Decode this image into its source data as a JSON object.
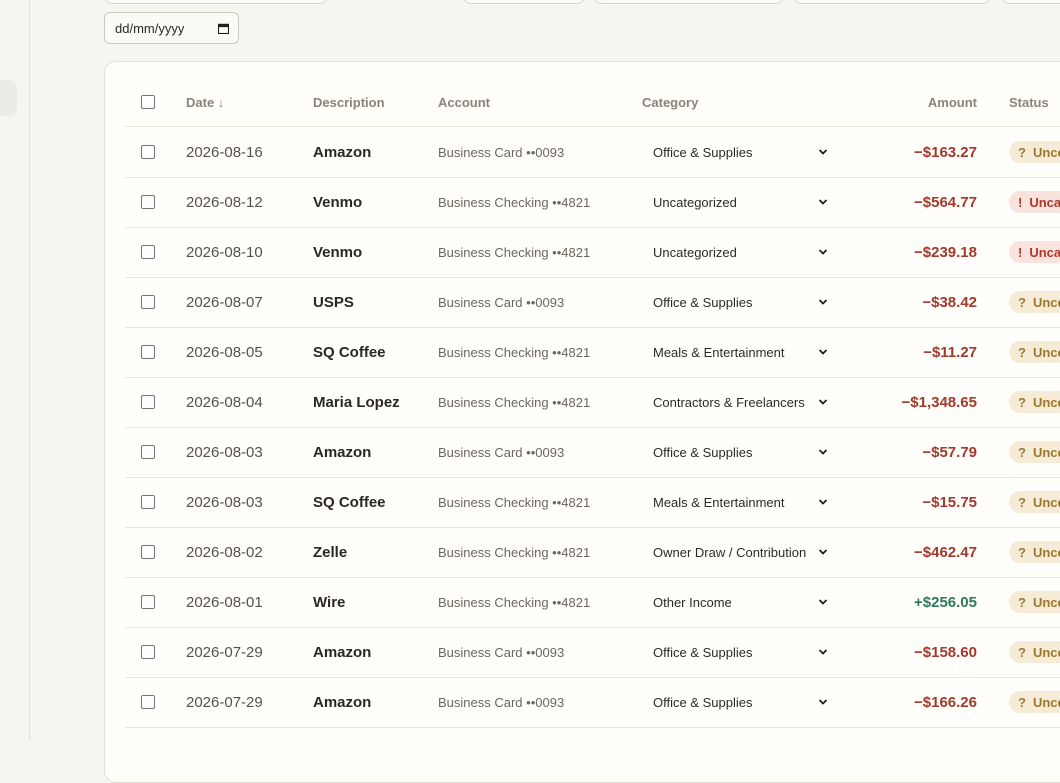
{
  "filters": {
    "date_placeholder": "dd/mm/yyyy"
  },
  "table": {
    "headers": {
      "date": "Date ↓",
      "description": "Description",
      "account": "Account",
      "category": "Category",
      "amount": "Amount",
      "status": "Status"
    },
    "rows": [
      {
        "date": "2026-08-16",
        "description": "Amazon",
        "account": "Business Card ••0093",
        "category": "Office & Supplies",
        "amount": "−$163.27",
        "sign": "neg",
        "status": "Uncertain",
        "status_kind": "uncertain",
        "status_icon": "?"
      },
      {
        "date": "2026-08-12",
        "description": "Venmo",
        "account": "Business Checking ••4821",
        "category": "Uncategorized",
        "amount": "−$564.77",
        "sign": "neg",
        "status": "Uncategorized",
        "status_kind": "uncat",
        "status_icon": "!"
      },
      {
        "date": "2026-08-10",
        "description": "Venmo",
        "account": "Business Checking ••4821",
        "category": "Uncategorized",
        "amount": "−$239.18",
        "sign": "neg",
        "status": "Uncategorized",
        "status_kind": "uncat",
        "status_icon": "!"
      },
      {
        "date": "2026-08-07",
        "description": "USPS",
        "account": "Business Card ••0093",
        "category": "Office & Supplies",
        "amount": "−$38.42",
        "sign": "neg",
        "status": "Uncertain",
        "status_kind": "uncertain",
        "status_icon": "?"
      },
      {
        "date": "2026-08-05",
        "description": "SQ Coffee",
        "account": "Business Checking ••4821",
        "category": "Meals & Entertainment",
        "amount": "−$11.27",
        "sign": "neg",
        "status": "Uncertain",
        "status_kind": "uncertain",
        "status_icon": "?"
      },
      {
        "date": "2026-08-04",
        "description": "Maria Lopez",
        "account": "Business Checking ••4821",
        "category": "Contractors & Freelancers",
        "amount": "−$1,348.65",
        "sign": "neg",
        "status": "Uncertain",
        "status_kind": "uncertain",
        "status_icon": "?"
      },
      {
        "date": "2026-08-03",
        "description": "Amazon",
        "account": "Business Card ••0093",
        "category": "Office & Supplies",
        "amount": "−$57.79",
        "sign": "neg",
        "status": "Uncertain",
        "status_kind": "uncertain",
        "status_icon": "?"
      },
      {
        "date": "2026-08-03",
        "description": "SQ Coffee",
        "account": "Business Checking ••4821",
        "category": "Meals & Entertainment",
        "amount": "−$15.75",
        "sign": "neg",
        "status": "Uncertain",
        "status_kind": "uncertain",
        "status_icon": "?"
      },
      {
        "date": "2026-08-02",
        "description": "Zelle",
        "account": "Business Checking ••4821",
        "category": "Owner Draw / Contribution",
        "amount": "−$462.47",
        "sign": "neg",
        "status": "Uncertain",
        "status_kind": "uncertain",
        "status_icon": "?"
      },
      {
        "date": "2026-08-01",
        "description": "Wire",
        "account": "Business Checking ••4821",
        "category": "Other Income",
        "amount": "+$256.05",
        "sign": "pos",
        "status": "Uncertain",
        "status_kind": "uncertain",
        "status_icon": "?"
      },
      {
        "date": "2026-07-29",
        "description": "Amazon",
        "account": "Business Card ••0093",
        "category": "Office & Supplies",
        "amount": "−$158.60",
        "sign": "neg",
        "status": "Uncertain",
        "status_kind": "uncertain",
        "status_icon": "?"
      },
      {
        "date": "2026-07-29",
        "description": "Amazon",
        "account": "Business Card ••0093",
        "category": "Office & Supplies",
        "amount": "−$166.26",
        "sign": "neg",
        "status": "Uncertain",
        "status_kind": "uncertain",
        "status_icon": "?"
      }
    ]
  },
  "colors": {
    "negative": "#a13a2a",
    "positive": "#2c7a5b",
    "uncertain_badge": "#f5ebd6",
    "uncategorized_badge": "#f8e3df"
  }
}
